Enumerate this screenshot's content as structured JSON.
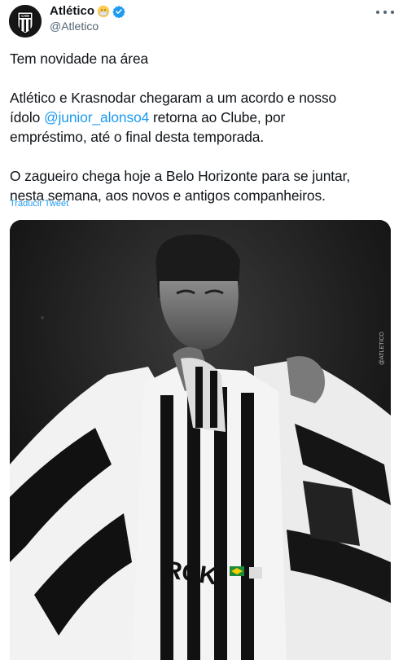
{
  "tweet": {
    "author_name": "Atlético",
    "author_handle": "@Atletico",
    "lines": {
      "l1": "Tem novidade na área",
      "l2a": "Atlético e Krasnodar chegaram a um acordo e nosso",
      "l3_pre": "ídolo ",
      "mention": "@junior_alonso4",
      "l3_post": " retorna ao Clube, por",
      "l4": "empréstimo, até o final desta temporada.",
      "l5": "O zagueiro chega hoje a Belo Horizonte para se juntar,",
      "l6": "nesta semana, aos novos e antigos companheiros."
    },
    "translate_label": "Traducir Tweet"
  },
  "media": {
    "crest_text": "CAM",
    "watermark": "@ATLETICO",
    "shirt_text": "RCK"
  },
  "colors": {
    "link": "#1d9bf0",
    "text": "#0f1419",
    "secondary": "#536471",
    "verified": "#1d9bf0"
  }
}
